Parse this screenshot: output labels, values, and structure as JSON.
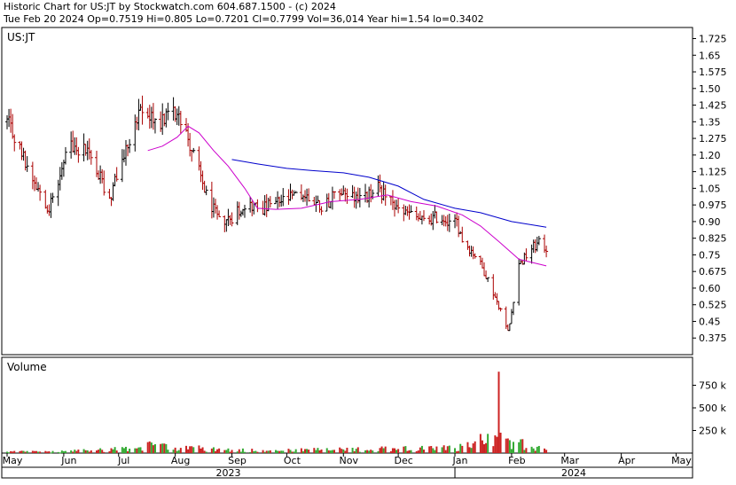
{
  "header": {
    "line1": "Historic Chart for US:JT by Stockwatch.com 604.687.1500 - (c) 2024",
    "line2": "Tue Feb 20 2024   Op=0.7519   Hi=0.805   Lo=0.7201   Cl=0.7799   Vol=36,014   Year hi=1.54   lo=0.3402"
  },
  "price_panel_label": "US:JT",
  "volume_panel_label": "Volume",
  "colors": {
    "up": "#000000",
    "down": "#aa0000",
    "ma_short": "#cc00cc",
    "ma_long": "#0000cc",
    "vol_up": "#33aa33",
    "vol_down": "#cc2222"
  },
  "chart_data": [
    {
      "type": "ohlc",
      "title": "US:JT",
      "ylim": [
        0.3,
        1.775
      ],
      "y_ticks": [
        "1.725",
        "1.65",
        "1.575",
        "1.50",
        "1.425",
        "1.35",
        "1.275",
        "1.20",
        "1.125",
        "1.05",
        "0.975",
        "0.90",
        "0.825",
        "0.75",
        "0.675",
        "0.60",
        "0.525",
        "0.45",
        "0.375"
      ],
      "x_ticks": [
        "May",
        "Jun",
        "Jul",
        "Aug",
        "Sep",
        "Oct",
        "Nov",
        "Dec",
        "Jan",
        "Feb",
        "Mar",
        "Apr",
        "May"
      ],
      "year_labels": [
        "2023",
        "2024"
      ],
      "series": [
        {
          "name": "price",
          "x_range": [
            "2023-05-01",
            "2024-02-20"
          ],
          "close_keypoints": [
            [
              "2023-05-01",
              1.35
            ],
            [
              "2023-05-12",
              1.15
            ],
            [
              "2023-05-24",
              0.96
            ],
            [
              "2023-06-05",
              1.25
            ],
            [
              "2023-06-14",
              1.22
            ],
            [
              "2023-06-26",
              1.0
            ],
            [
              "2023-07-04",
              1.2
            ],
            [
              "2023-07-08",
              1.3
            ],
            [
              "2023-07-14",
              1.4
            ],
            [
              "2023-07-22",
              1.35
            ],
            [
              "2023-08-03",
              1.4
            ],
            [
              "2023-08-09",
              1.25
            ],
            [
              "2023-08-18",
              1.02
            ],
            [
              "2023-08-25",
              0.9
            ],
            [
              "2023-09-01",
              0.92
            ],
            [
              "2023-09-08",
              0.98
            ],
            [
              "2023-09-18",
              0.96
            ],
            [
              "2023-10-01",
              1.0
            ],
            [
              "2023-10-10",
              1.02
            ],
            [
              "2023-10-20",
              0.97
            ],
            [
              "2023-11-01",
              1.04
            ],
            [
              "2023-11-12",
              1.0
            ],
            [
              "2023-11-20",
              1.05
            ],
            [
              "2023-12-01",
              0.95
            ],
            [
              "2023-12-08",
              0.93
            ],
            [
              "2023-12-15",
              0.9
            ],
            [
              "2023-12-22",
              0.92
            ],
            [
              "2024-01-02",
              0.9
            ],
            [
              "2024-01-05",
              0.82
            ],
            [
              "2024-01-12",
              0.75
            ],
            [
              "2024-01-18",
              0.66
            ],
            [
              "2024-01-25",
              0.52
            ],
            [
              "2024-01-30",
              0.4
            ],
            [
              "2024-02-05",
              0.7
            ],
            [
              "2024-02-12",
              0.78
            ],
            [
              "2024-02-16",
              0.8
            ],
            [
              "2024-02-20",
              0.78
            ]
          ]
        },
        {
          "name": "ma_short",
          "points": [
            [
              "2023-07-17",
              1.22
            ],
            [
              "2023-07-25",
              1.24
            ],
            [
              "2023-08-02",
              1.28
            ],
            [
              "2023-08-08",
              1.33
            ],
            [
              "2023-08-14",
              1.3
            ],
            [
              "2023-08-22",
              1.22
            ],
            [
              "2023-08-30",
              1.15
            ],
            [
              "2023-09-08",
              1.05
            ],
            [
              "2023-09-15",
              0.96
            ],
            [
              "2023-09-25",
              0.955
            ],
            [
              "2023-10-09",
              0.96
            ],
            [
              "2023-10-25",
              0.99
            ],
            [
              "2023-11-10",
              1.0
            ],
            [
              "2023-11-25",
              1.02
            ],
            [
              "2023-12-08",
              0.99
            ],
            [
              "2023-12-22",
              0.97
            ],
            [
              "2024-01-05",
              0.93
            ],
            [
              "2024-01-15",
              0.88
            ],
            [
              "2024-01-25",
              0.81
            ],
            [
              "2024-02-05",
              0.73
            ],
            [
              "2024-02-15",
              0.71
            ],
            [
              "2024-02-20",
              0.7
            ]
          ]
        },
        {
          "name": "ma_long",
          "points": [
            [
              "2023-09-01",
              1.18
            ],
            [
              "2023-09-15",
              1.16
            ],
            [
              "2023-10-01",
              1.14
            ],
            [
              "2023-10-15",
              1.13
            ],
            [
              "2023-11-01",
              1.12
            ],
            [
              "2023-11-15",
              1.1
            ],
            [
              "2023-12-01",
              1.06
            ],
            [
              "2023-12-15",
              1.0
            ],
            [
              "2024-01-01",
              0.96
            ],
            [
              "2024-01-15",
              0.94
            ],
            [
              "2024-02-01",
              0.9
            ],
            [
              "2024-02-20",
              0.875
            ]
          ]
        }
      ]
    },
    {
      "type": "bar",
      "title": "Volume",
      "ylim": [
        0,
        1000000
      ],
      "y_ticks": [
        "750 k",
        "500 k",
        "250 k"
      ],
      "series": [
        {
          "name": "volume",
          "keypoints": [
            [
              "2023-05-01",
              15000
            ],
            [
              "2023-06-01",
              20000
            ],
            [
              "2023-07-01",
              45000
            ],
            [
              "2023-07-15",
              80000
            ],
            [
              "2023-08-01",
              60000
            ],
            [
              "2023-08-15",
              50000
            ],
            [
              "2023-09-01",
              35000
            ],
            [
              "2023-10-01",
              30000
            ],
            [
              "2023-11-01",
              40000
            ],
            [
              "2023-12-01",
              45000
            ],
            [
              "2024-01-01",
              55000
            ],
            [
              "2024-01-25",
              900000
            ],
            [
              "2024-01-24",
              180000
            ],
            [
              "2024-01-29",
              160000
            ],
            [
              "2024-02-05",
              120000
            ],
            [
              "2024-02-20",
              36014
            ]
          ]
        }
      ]
    }
  ]
}
